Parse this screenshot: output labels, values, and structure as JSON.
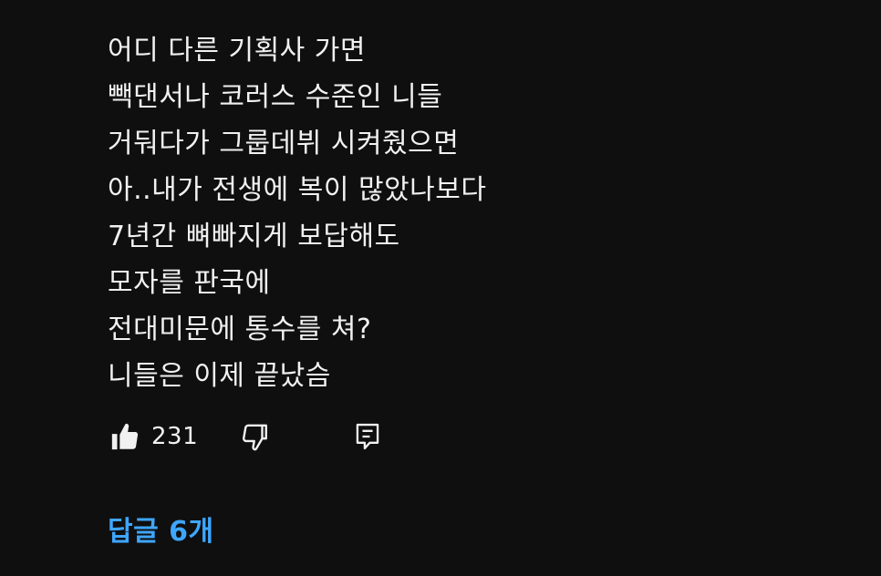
{
  "comment": {
    "lines": [
      "어디 다른 기획사 가면",
      "빽댄서나 코러스 수준인 니들",
      "거둬다가 그룹데뷔 시켜줬으면",
      "아..내가 전생에 복이 많았나보다",
      "7년간 뼈빠지게 보답해도",
      "모자를 판국에",
      "전대미문에 통수를 쳐?",
      "니들은 이제 끝났슴"
    ]
  },
  "actions": {
    "like_count": "231",
    "icons": [
      "thumbs-up-icon",
      "thumbs-down-icon",
      "reply-icon"
    ]
  },
  "replies": {
    "label": "답글 6개"
  },
  "colors": {
    "background": "#0f0f0f",
    "text": "#f1f1f1",
    "link": "#3ea6ff"
  }
}
